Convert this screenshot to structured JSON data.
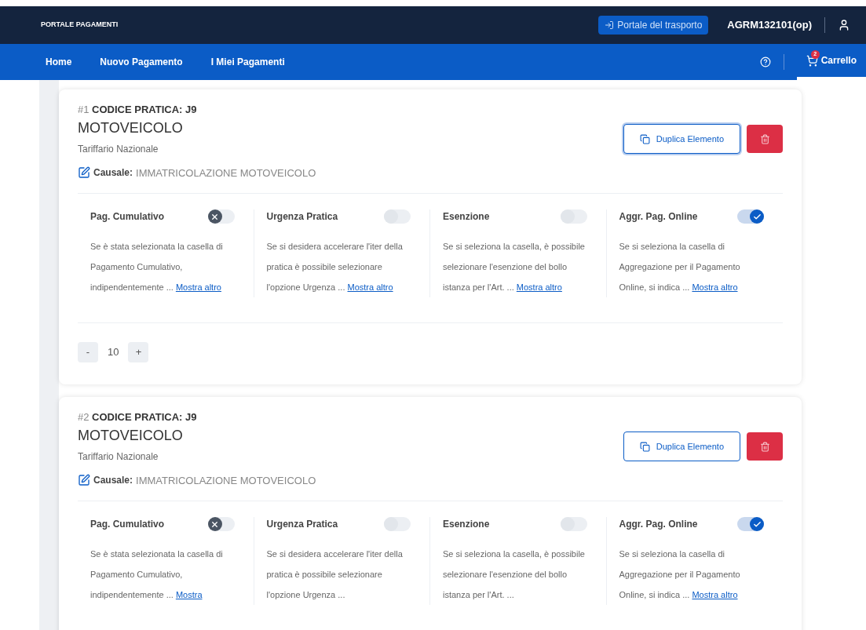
{
  "topbar": {
    "title": "PORTALE PAGAMENTI",
    "portal_link": "Portale del trasporto",
    "user": "AGRM132101(op)"
  },
  "nav": {
    "items": [
      {
        "label": "Home"
      },
      {
        "label": "Nuovo Pagamento"
      },
      {
        "label": "I Miei Pagamenti"
      }
    ],
    "cart": {
      "label": "Carrello",
      "badge": "2",
      "selected": true
    }
  },
  "cards": [
    {
      "number": "#1",
      "code": "CODICE PRATICA: J9",
      "title": "MOTOVEICOLO",
      "subtitle": "Tariffario Nazionale",
      "causale_label": "Causale:",
      "causale": "IMMATRICOLAZIONE MOTOVEICOLO",
      "duplicate_label": "Duplica Elemento",
      "duplicate_focused": true,
      "options": [
        {
          "title": "Pag. Cumulativo",
          "on": false,
          "blocked": true,
          "text": "Se è stata selezionata la casella di Pagamento Cumulativo, indipendentemente ...",
          "link": "Mostra altro"
        },
        {
          "title": "Urgenza Pratica",
          "on": false,
          "blocked": false,
          "text": "Se si desidera accelerare l'iter della pratica è possibile selezionare l'opzione Urgenza ...",
          "link": "Mostra altro"
        },
        {
          "title": "Esenzione",
          "on": false,
          "blocked": false,
          "text": "Se si seleziona la casella, è possibile selezionare l'esenzione del bollo istanza per l'Art. ...",
          "link": "Mostra altro"
        },
        {
          "title": "Aggr. Pag. Online",
          "on": true,
          "blocked": false,
          "text": "Se si seleziona la casella di Aggregazione per il Pagamento Online, si indica ...",
          "link": "Mostra altro"
        }
      ],
      "quantity": {
        "minus": "-",
        "value": "10",
        "plus": "+"
      }
    },
    {
      "number": "#2",
      "code": "CODICE PRATICA: J9",
      "title": "MOTOVEICOLO",
      "subtitle": "Tariffario Nazionale",
      "causale_label": "Causale:",
      "causale": "IMMATRICOLAZIONE MOTOVEICOLO",
      "duplicate_label": "Duplica Elemento",
      "duplicate_focused": false,
      "options": [
        {
          "title": "Pag. Cumulativo",
          "on": false,
          "blocked": true,
          "text": "Se è stata selezionata la casella di Pagamento Cumulativo, indipendentemente ...",
          "link": "Mostra"
        },
        {
          "title": "Urgenza Pratica",
          "on": false,
          "blocked": false,
          "text": "Se si desidera accelerare l'iter della pratica è possibile selezionare l'opzione Urgenza ..."
        },
        {
          "title": "Esenzione",
          "on": false,
          "blocked": false,
          "text": "Se si seleziona la casella, è possibile selezionare l'esenzione del bollo istanza per l'Art. ..."
        },
        {
          "title": "Aggr. Pag. Online",
          "on": true,
          "blocked": false,
          "text": "Se si seleziona la casella di Aggregazione per il Pagamento Online, si indica ...",
          "link": "Mostra altro"
        }
      ]
    }
  ]
}
